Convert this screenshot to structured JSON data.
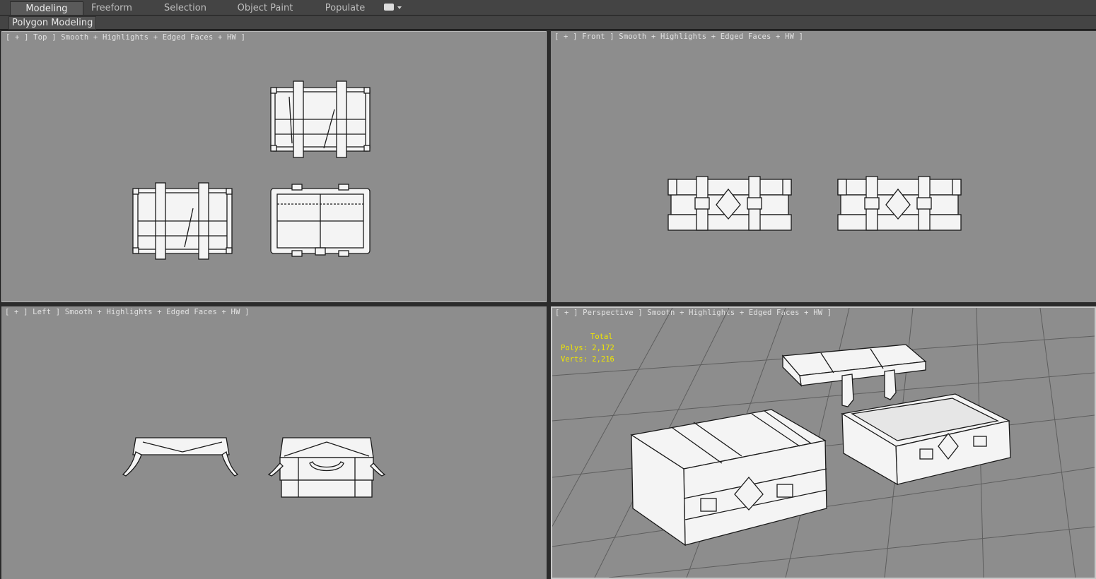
{
  "ribbon": {
    "tabs": [
      {
        "label": "Modeling",
        "active": true
      },
      {
        "label": "Freeform",
        "active": false
      },
      {
        "label": "Selection",
        "active": false
      },
      {
        "label": "Object Paint",
        "active": false
      },
      {
        "label": "Populate",
        "active": false
      }
    ],
    "dropdown_icon": "panel-options-icon",
    "panel_label": "Polygon Modeling"
  },
  "viewports": {
    "top": {
      "label": "[ + ] Top ] Smooth + Highlights + Edged Faces + HW ]"
    },
    "front": {
      "label": "[ + ] Front ] Smooth + Highlights + Edged Faces + HW ]"
    },
    "left": {
      "label": "[ + ] Left ] Smooth + Highlights + Edged Faces + HW ]"
    },
    "perspective": {
      "label": "[ + ] Perspective ] Smooth + Highlights + Edged Faces + HW ]",
      "stats": {
        "total": "Total",
        "polys": "Polys: 2,172",
        "verts": "Verts: 2,216"
      }
    }
  },
  "colors": {
    "viewport_bg": "#8d8d8d",
    "ui_bg": "#444444",
    "model_fill": "#f4f4f4",
    "model_edge": "#1a1a1a",
    "stats_text": "#f0e600",
    "grid_line": "#5e5e5e"
  }
}
